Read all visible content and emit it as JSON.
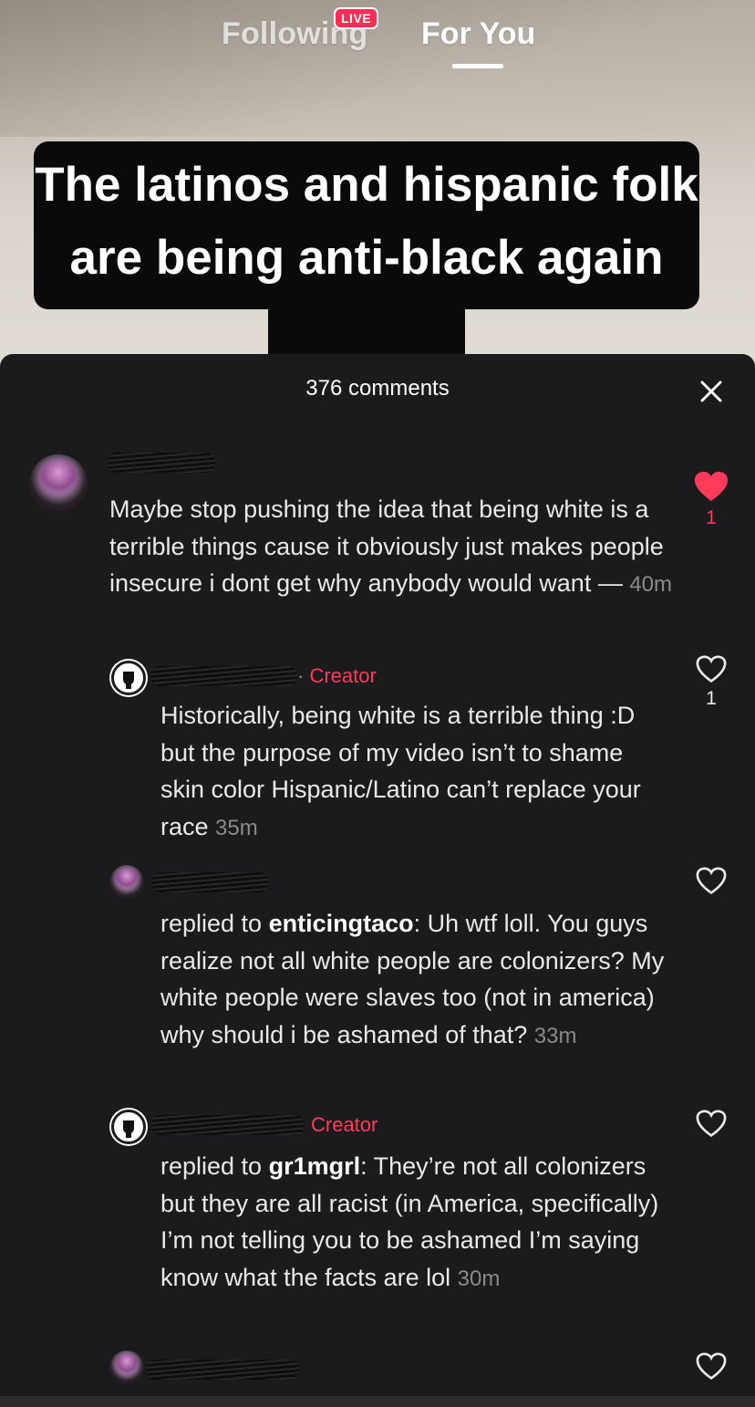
{
  "nav": {
    "following_label": "Following",
    "live_badge": "LIVE",
    "for_you_label": "For You"
  },
  "video": {
    "caption": "The latinos and hispanic folk are being anti-black again"
  },
  "comments_sheet": {
    "title": "376 comments",
    "accent_color": "#ff3b5c",
    "comments": [
      {
        "text": "Maybe stop pushing the idea that being white is a terrible things cause it obviously just makes people insecure i dont get why anybody would want — ",
        "time": "40m",
        "likes": "1",
        "liked": true
      },
      {
        "creator_label": "Creator",
        "text": "Historically, being white is a terrible thing :D but the purpose of my video isn’t to shame skin color Hispanic/Latino can’t replace your race ",
        "time": "35m",
        "likes": "1",
        "liked": false
      },
      {
        "reply_prefix": "replied to ",
        "reply_to": "enticingtaco",
        "text": ": Uh wtf loll. You guys realize not all white people are colonizers? My white people were slaves too (not in america) why should i be ashamed of that? ",
        "time": "33m",
        "liked": false
      },
      {
        "creator_label": "Creator",
        "reply_prefix": "replied to ",
        "reply_to": "gr1mgrl",
        "text": ": They’re not all colonizers but they are all racist (in America, specifically) I’m not telling you to be ashamed I’m saying know what the facts are lol ",
        "time": "30m",
        "liked": false
      },
      {
        "liked": false
      }
    ]
  }
}
